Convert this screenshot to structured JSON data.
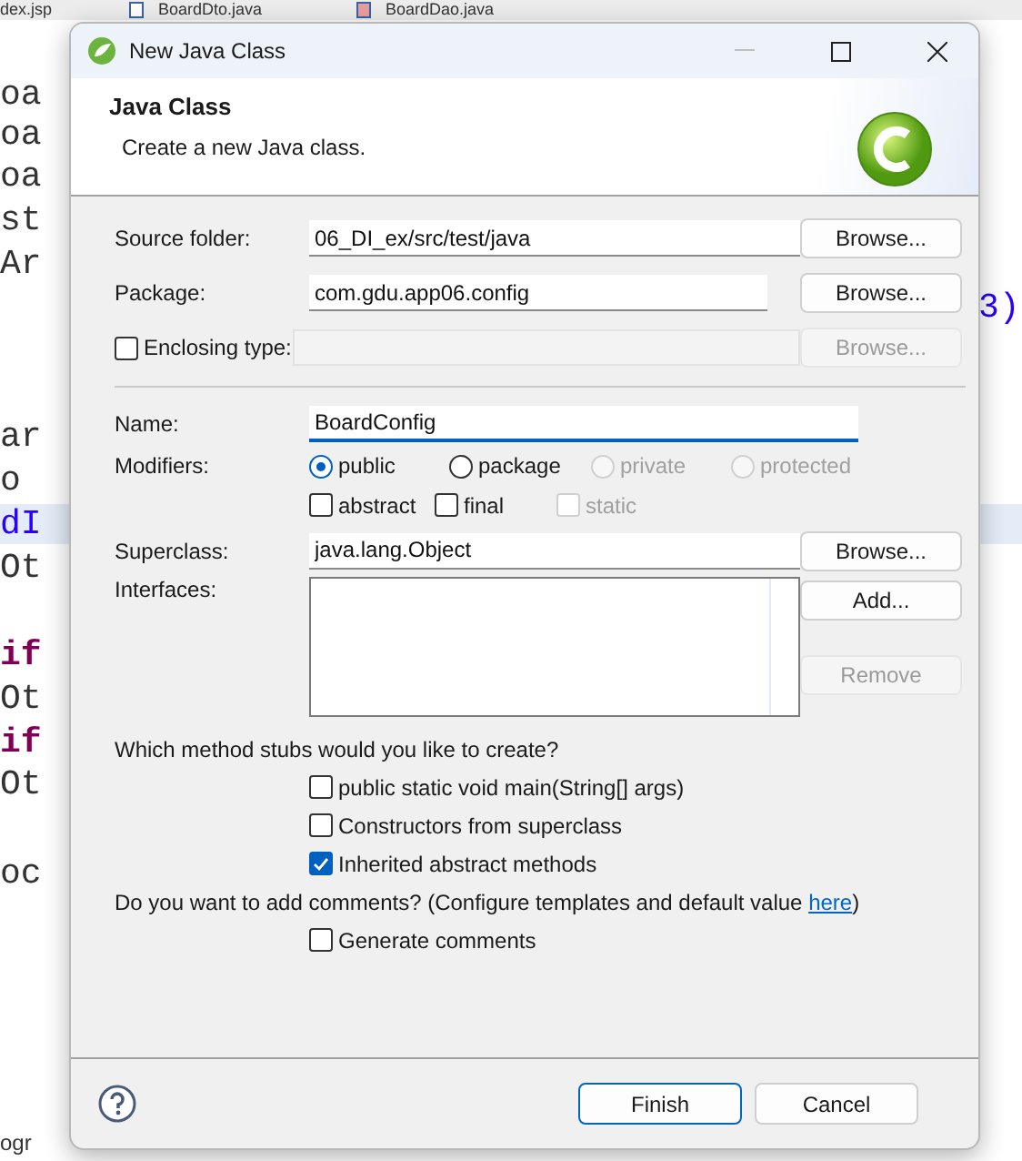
{
  "background": {
    "tabs": [
      {
        "label": "dex.jsp"
      },
      {
        "label": "BoardDto.java",
        "kind": "java"
      },
      {
        "label": "BoardDao.java",
        "kind": "java-error"
      }
    ],
    "code_lines": [
      {
        "text": "oa",
        "kind": "plain",
        "highlighted": false
      },
      {
        "text": "oa",
        "kind": "plain",
        "highlighted": false
      },
      {
        "text": "oa",
        "kind": "plain",
        "highlighted": false
      },
      {
        "text": "st",
        "kind": "plain",
        "highlighted": false
      },
      {
        "text": "Ar",
        "kind": "plain",
        "highlighted": false
      },
      {
        "text": "ar",
        "kind": "plain",
        "highlighted": false
      },
      {
        "text": "o",
        "kind": "plain",
        "highlighted": false
      },
      {
        "text": "dI",
        "kind": "number",
        "highlighted": true
      },
      {
        "text": "Ot",
        "kind": "plain",
        "highlighted": false
      },
      {
        "text": "if",
        "kind": "keyword",
        "highlighted": false
      },
      {
        "text": "Ot",
        "kind": "plain",
        "highlighted": false
      },
      {
        "text": "if",
        "kind": "keyword",
        "highlighted": false
      },
      {
        "text": "Ot",
        "kind": "plain",
        "highlighted": false
      },
      {
        "text": "oc",
        "kind": "plain",
        "highlighted": false
      }
    ],
    "right_fragment": "3)",
    "status_fragment": "ogr"
  },
  "window": {
    "title": "New Java Class"
  },
  "header": {
    "title": "Java Class",
    "description": "Create a new Java class."
  },
  "source_folder": {
    "label": "Source folder:",
    "value": "06_DI_ex/src/test/java",
    "button": "Browse..."
  },
  "package": {
    "label": "Package:",
    "value": "com.gdu.app06.config",
    "button": "Browse..."
  },
  "enclosing_type": {
    "label": "Enclosing type:",
    "checked": false,
    "button": "Browse...",
    "disabled": true
  },
  "name": {
    "label": "Name:",
    "value": "BoardConfig",
    "focused": true
  },
  "modifiers": {
    "label": "Modifiers:",
    "access": [
      {
        "label": "public",
        "selected": true,
        "disabled": false
      },
      {
        "label": "package",
        "selected": false,
        "disabled": false
      },
      {
        "label": "private",
        "selected": false,
        "disabled": true
      },
      {
        "label": "protected",
        "selected": false,
        "disabled": true
      }
    ],
    "flags": [
      {
        "label": "abstract",
        "checked": false,
        "disabled": false
      },
      {
        "label": "final",
        "checked": false,
        "disabled": false
      },
      {
        "label": "static",
        "checked": false,
        "disabled": true
      }
    ]
  },
  "superclass": {
    "label": "Superclass:",
    "value": "java.lang.Object",
    "button": "Browse..."
  },
  "interfaces": {
    "label": "Interfaces:",
    "buttons": [
      {
        "label": "Add...",
        "disabled": false
      },
      {
        "label": "Remove",
        "disabled": true
      }
    ]
  },
  "stubs": {
    "question": "Which method stubs would you like to create?",
    "options": [
      {
        "label": "public static void main(String[] args)",
        "checked": false
      },
      {
        "label": "Constructors from superclass",
        "checked": false
      },
      {
        "label": "Inherited abstract methods",
        "checked": true
      }
    ]
  },
  "comments": {
    "before": "Do you want to add comments? (Configure templates and default value ",
    "link": "here",
    "after": ")",
    "option": {
      "label": "Generate comments",
      "checked": false
    }
  },
  "footer": {
    "buttons": [
      {
        "label": "Finish",
        "default": true
      },
      {
        "label": "Cancel",
        "default": false
      }
    ]
  }
}
